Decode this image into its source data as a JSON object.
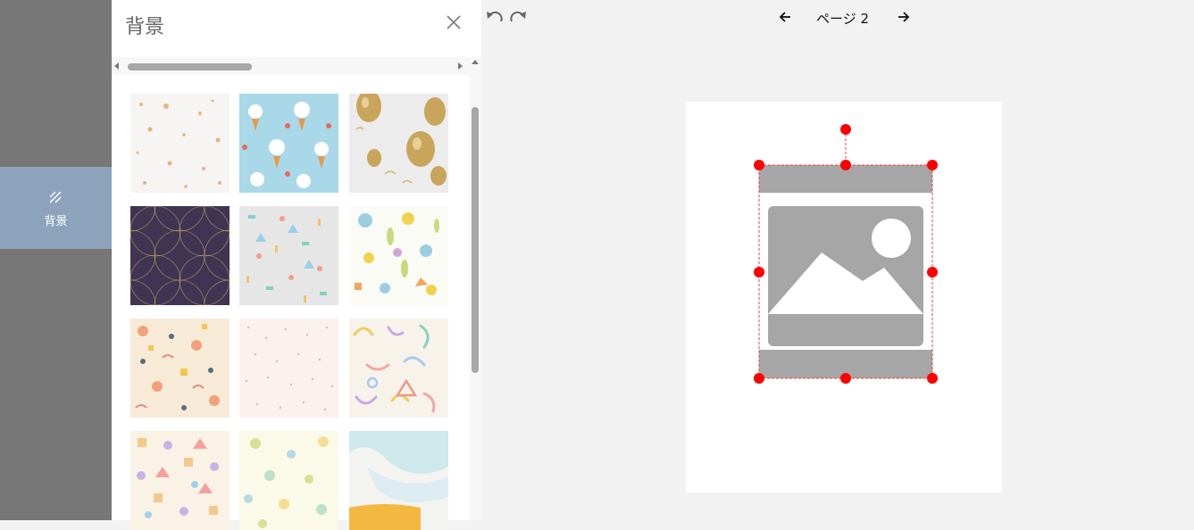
{
  "rail": {
    "active_label": "背景"
  },
  "panel": {
    "title": "背景",
    "close_icon": "close-icon"
  },
  "backgrounds": [
    "pattern-gold-stars",
    "pattern-ice-cream-blue",
    "pattern-gold-balloons",
    "pattern-purple-geometric",
    "pattern-confetti-grey",
    "pattern-doodle-shapes",
    "pattern-retro-shapes",
    "pattern-pink-dots",
    "pattern-pastel-squiggles",
    "pattern-pastel-confetti",
    "pattern-watercolor-dots",
    "pattern-watercolor-wash"
  ],
  "toolbar": {
    "page_label": "ページ 2"
  },
  "colors": {
    "rail": "#777777",
    "rail_active": "#8ca3bb",
    "handle": "#ff0000",
    "placeholder": "#a6a6a6"
  }
}
